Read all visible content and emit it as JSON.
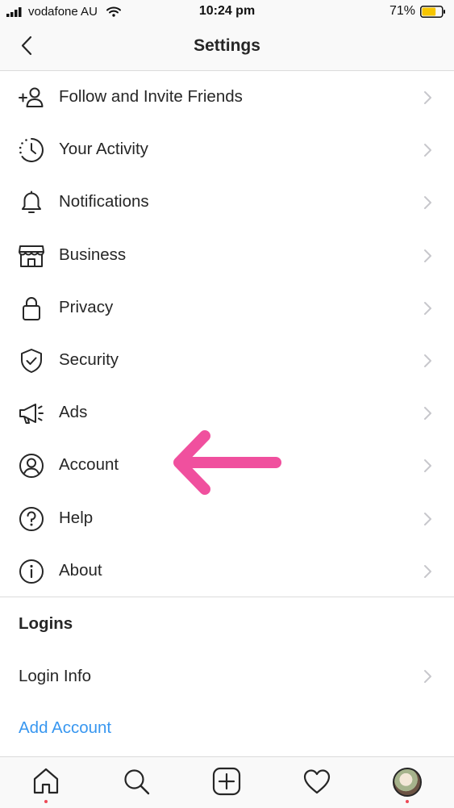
{
  "status_bar": {
    "carrier": "vodafone AU",
    "time": "10:24 pm",
    "battery_percent": "71%",
    "battery_level": 0.71,
    "signal_icon": "signal-bars-icon",
    "wifi_icon": "wifi-icon"
  },
  "header": {
    "title": "Settings",
    "back_icon": "chevron-left-icon"
  },
  "menu": [
    {
      "label": "Follow and Invite Friends",
      "icon": "add-friend-icon"
    },
    {
      "label": "Your Activity",
      "icon": "activity-icon"
    },
    {
      "label": "Notifications",
      "icon": "bell-icon"
    },
    {
      "label": "Business",
      "icon": "shop-icon"
    },
    {
      "label": "Privacy",
      "icon": "lock-icon"
    },
    {
      "label": "Security",
      "icon": "shield-icon"
    },
    {
      "label": "Ads",
      "icon": "megaphone-icon"
    },
    {
      "label": "Account",
      "icon": "account-icon"
    },
    {
      "label": "Help",
      "icon": "help-icon"
    },
    {
      "label": "About",
      "icon": "info-icon"
    }
  ],
  "logins": {
    "header": "Logins",
    "login_info": "Login Info",
    "add_account": "Add Account"
  },
  "tab_bar": {
    "items": [
      "home-icon",
      "search-icon",
      "new-post-icon",
      "heart-icon",
      "profile-avatar"
    ]
  },
  "colors": {
    "accent_link": "#3897f0",
    "annotation_arrow": "#f0509e",
    "notification_dot": "#ed4956"
  }
}
